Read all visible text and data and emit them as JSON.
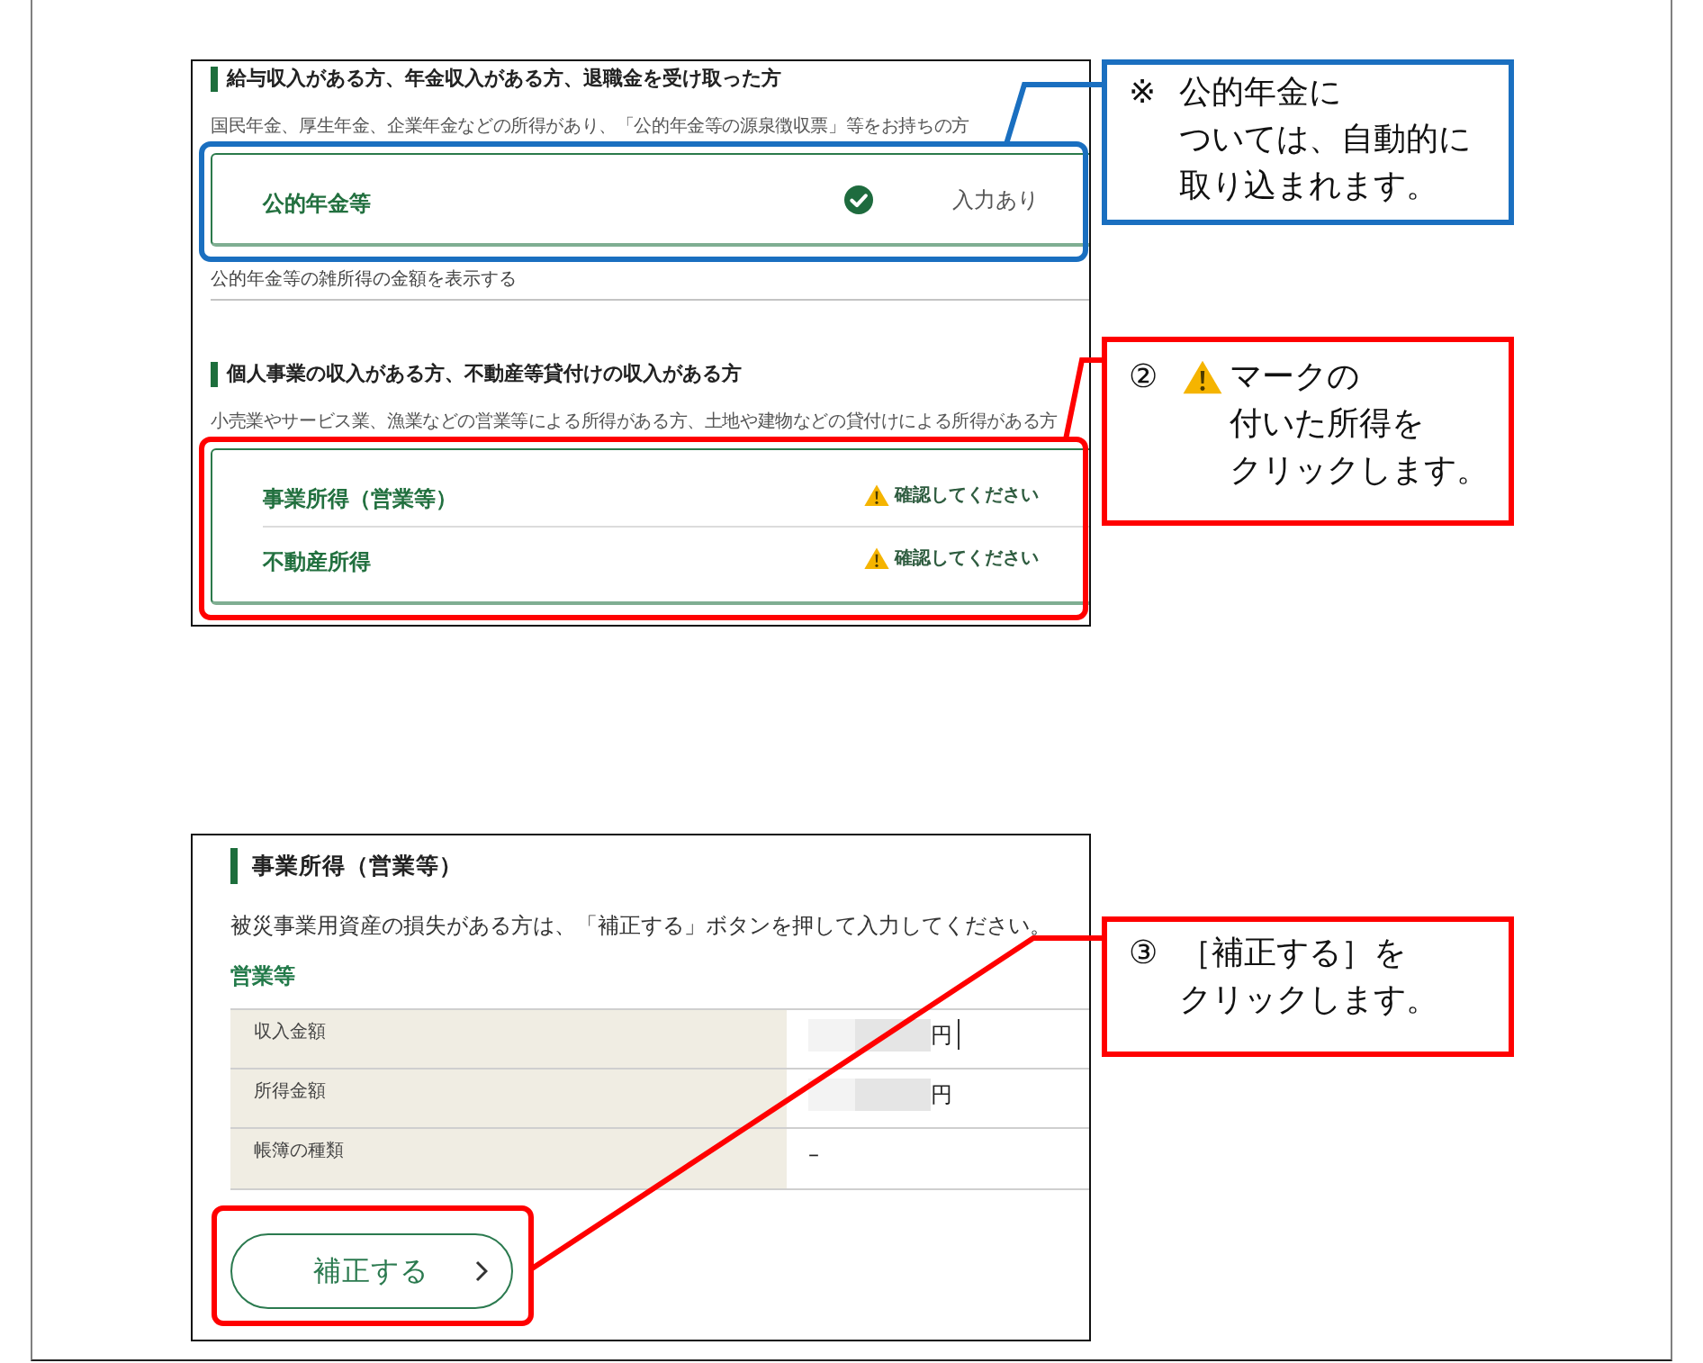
{
  "panels": [
    {
      "kind": "income_list",
      "screenshot": {
        "sections": [
          {
            "heading": "給与収入がある方、年金収入がある方、退職金を受け取った方",
            "description": "国民年金、厚生年金、企業年金などの所得があり、「公的年金等の源泉徴収票」等をお持ちの方",
            "items": [
              {
                "label": "公的年金等",
                "kind": "done",
                "status": "入力あり"
              }
            ],
            "link": "公的年金等の雑所得の金額を表示する"
          },
          {
            "heading": "個人事業の収入がある方、不動産等貸付けの収入がある方",
            "description": "小売業やサービス業、漁業などの営業等による所得がある方、土地や建物などの貸付けによる所得がある方",
            "items": [
              {
                "label": "事業所得（営業等）",
                "kind": "warning",
                "status": "確認してください"
              },
              {
                "label": "不動産所得",
                "kind": "warning",
                "status": "確認してください"
              }
            ]
          }
        ]
      },
      "callouts": [
        {
          "kind": "note",
          "marker": "※",
          "lines": [
            "公的年金に",
            "ついては、自動的に",
            "取り込まれます。"
          ],
          "color": "#1a6fc0"
        },
        {
          "kind": "warning",
          "marker": "②",
          "lines": [
            "マークの",
            "付いた所得を",
            "クリックします。"
          ],
          "color": "#ff0000"
        }
      ]
    },
    {
      "kind": "business_detail",
      "screenshot": {
        "heading": "事業所得（営業等）",
        "notice": "被災事業用資産の損失がある方は、「補正する」ボタンを押して入力してください。",
        "subheading": "営業等",
        "rows": [
          {
            "label": "収入金額",
            "value": "円",
            "redacted": true,
            "cursor": true
          },
          {
            "label": "所得金額",
            "value": "円",
            "redacted": true,
            "cursor": false
          },
          {
            "label": "帳簿の種類",
            "value": "–",
            "redacted": false,
            "cursor": false
          }
        ],
        "button": "補正する"
      },
      "callouts": [
        {
          "kind": "step",
          "marker": "③",
          "lines": [
            "［補正する］を",
            "クリックします。"
          ],
          "color": "#ff0000"
        }
      ]
    }
  ]
}
